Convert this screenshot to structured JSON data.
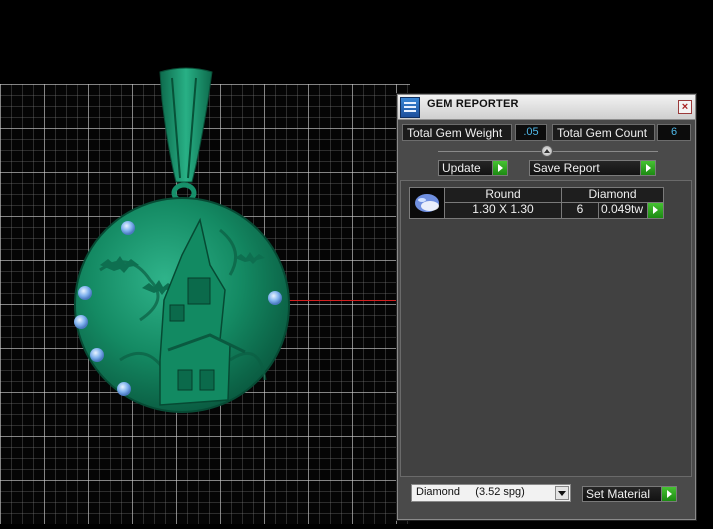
{
  "panel": {
    "title": "GEM REPORTER",
    "close_glyph": "×",
    "app_icon": "gem-report-icon",
    "total_weight_label": "Total Gem Weight",
    "total_weight_value": ".05",
    "total_count_label": "Total Gem Count",
    "total_count_value": "6",
    "update_label": "Update",
    "save_report_label": "Save Report",
    "table": {
      "headers": [
        "Round",
        "Diamond"
      ],
      "rows": [
        {
          "icon": "diamond-gem-icon",
          "size": "1.30 X 1.30",
          "count": "6",
          "weight": "0.049tw"
        }
      ]
    },
    "material_select": "Diamond     (3.52 spg)",
    "set_material_label": "Set Material"
  },
  "colors": {
    "accent_value": "#4fb8e8",
    "button_arrow": "#2fa820",
    "model": "#1a8a68",
    "gem": "#6ea6e8"
  }
}
